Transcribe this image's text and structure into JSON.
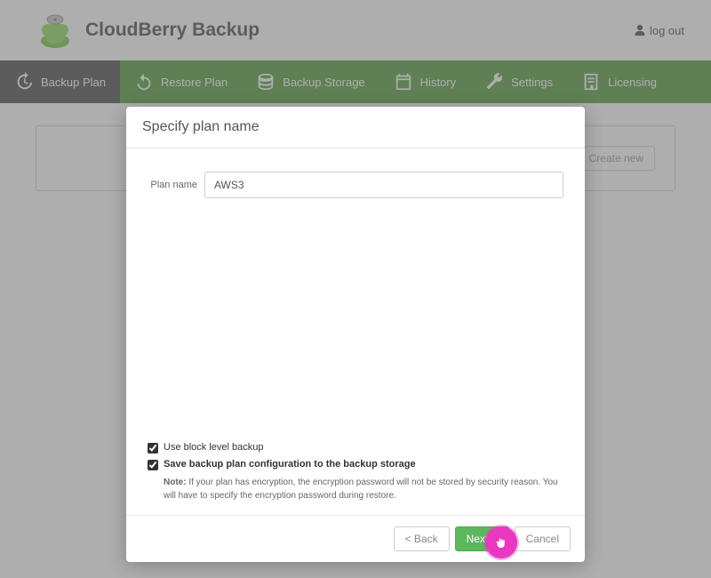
{
  "header": {
    "brand": "CloudBerry Backup",
    "logout": "log out"
  },
  "nav": {
    "items": [
      {
        "label": "Backup Plan"
      },
      {
        "label": "Restore Plan"
      },
      {
        "label": "Backup Storage"
      },
      {
        "label": "History"
      },
      {
        "label": "Settings"
      },
      {
        "label": "Licensing"
      }
    ]
  },
  "panel": {
    "create_btn": "Create new"
  },
  "modal": {
    "title": "Specify plan name",
    "plan_name_label": "Plan name",
    "plan_name_value": "AWS3",
    "opt_block_level": "Use block level backup",
    "opt_save_config": "Save backup plan configuration to the backup storage",
    "note_label": "Note:",
    "note_text": " If your plan has encryption, the encryption password will not be stored by security reason. You will have to specify the encryption password during restore.",
    "back_btn": "< Back",
    "next_btn": "Next >",
    "cancel_btn": "Cancel"
  }
}
